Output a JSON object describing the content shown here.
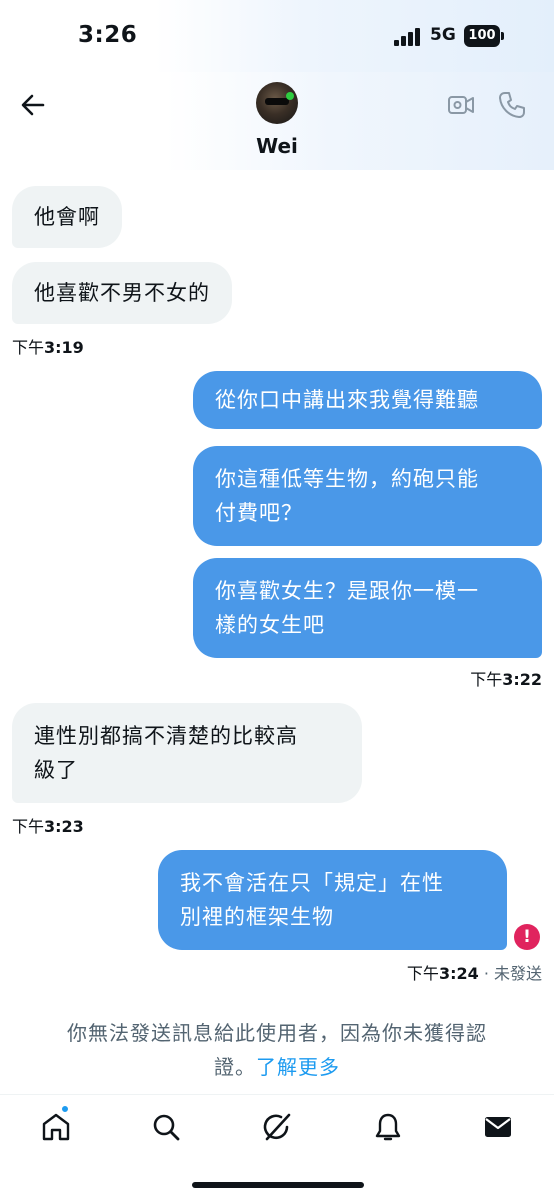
{
  "status_bar": {
    "time": "3:26",
    "network": "5G",
    "battery": "100"
  },
  "header": {
    "contact_name": "Wei"
  },
  "messages": [
    {
      "text": "他會啊"
    },
    {
      "text": "他喜歡不男不女的"
    },
    {
      "text": "從你口中講出來我覺得難聽"
    },
    {
      "line1": "你這種低等生物，約砲只能",
      "line2": "付費吧？"
    },
    {
      "line1": "你喜歡女生？是跟你一模一",
      "line2": "樣的女生吧"
    },
    {
      "line1": "連性別都搞不清楚的比較高",
      "line2": "級了"
    },
    {
      "line1": "我不會活在只「規定」在性",
      "line2": "別裡的框架生物"
    }
  ],
  "timestamps": {
    "t1": {
      "prefix": "下午",
      "time": "3:19"
    },
    "t2": {
      "prefix": "下午",
      "time": "3:22"
    },
    "t3": {
      "prefix": "下午",
      "time": "3:23"
    },
    "t4": {
      "prefix": "下午",
      "time": "3:24",
      "status": " · 未發送"
    }
  },
  "error_badge": "!",
  "notice": {
    "text_line1": "你無法發送訊息給此使用者，因為你未獲得認",
    "text_line2": "證。",
    "link": "了解更多"
  },
  "icons": [
    "back-arrow-icon",
    "video-call-icon",
    "phone-icon",
    "home-icon",
    "search-icon",
    "grok-icon",
    "bell-icon",
    "messages-icon"
  ]
}
